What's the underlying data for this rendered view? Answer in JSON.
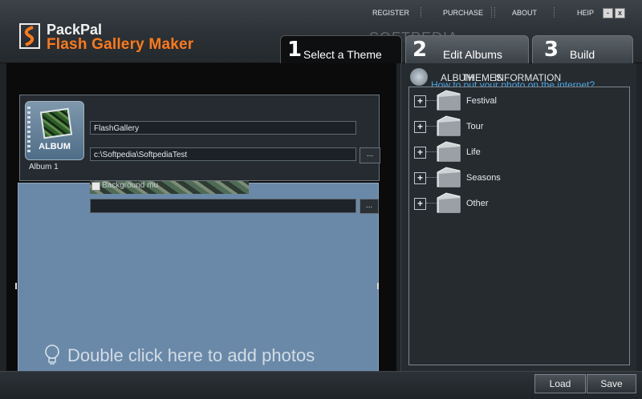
{
  "app": {
    "brand_line1": "PackPal",
    "brand_line2": "Flash Gallery Maker",
    "watermark": "SOFTPEDIA"
  },
  "topmenu": {
    "register": "REGISTER",
    "purchase": "PURCHASE",
    "about": "ABOUT",
    "help": "HEIP",
    "minimize": "-",
    "close": "x"
  },
  "steps": [
    {
      "num": "1",
      "label": "Select a Theme"
    },
    {
      "num": "2",
      "label": "Edit Albums"
    },
    {
      "num": "3",
      "label": "Build"
    }
  ],
  "album_dialog": {
    "tile_label": "ALBUM",
    "album_name": "Album 1",
    "gallery_name": "FlashGallery",
    "path": "c:\\Softpedia\\SoftpediaTest",
    "browse": "...",
    "background_music_label": "Background mu",
    "music_browse": "..."
  },
  "canvas": {
    "hint": "Double click  here to add photos"
  },
  "right_panel": {
    "title_a": "ALBUM",
    "title_b": "THEMES",
    "title_c": "INFORMATION",
    "link": "How to put your photo on the internet?",
    "themes": [
      "Festival",
      "Tour",
      "Life",
      "Seasons",
      "Other"
    ]
  },
  "buttons": {
    "load": "Load",
    "save": "Save"
  },
  "colors": {
    "brand_orange": "#ff7a1a",
    "canvas_blue": "#6a89a8",
    "link_blue": "#4aa6e6"
  }
}
